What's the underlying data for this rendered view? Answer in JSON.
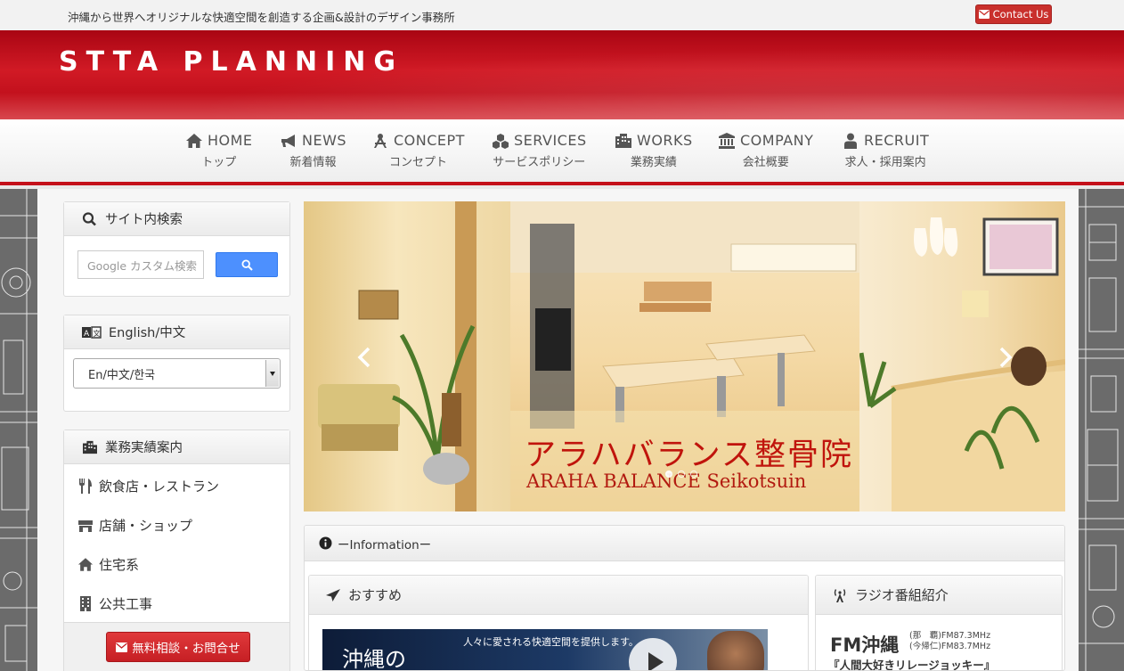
{
  "topbar": {
    "tagline": "沖縄から世界へオリジナルな快適空間を創造する企画&設計のデザイン事務所",
    "contact_label": "Contact Us"
  },
  "header": {
    "brand": "STTA PLANNING"
  },
  "colors": {
    "brand_red": "#c4101a",
    "search_blue": "#4d90fe",
    "button_red": "#c9302c"
  },
  "nav": [
    {
      "icon": "home-icon",
      "label": "HOME",
      "sub": "トップ"
    },
    {
      "icon": "bullhorn-icon",
      "label": "NEWS",
      "sub": "新着情報"
    },
    {
      "icon": "compass-icon",
      "label": "CONCEPT",
      "sub": "コンセプト"
    },
    {
      "icon": "cubes-icon",
      "label": "SERVICES",
      "sub": "サービスポリシー"
    },
    {
      "icon": "building-icon",
      "label": "WORKS",
      "sub": "業務実績"
    },
    {
      "icon": "bank-icon",
      "label": "COMPANY",
      "sub": "会社概要"
    },
    {
      "icon": "user-icon",
      "label": "RECRUIT",
      "sub": "求人・採用案内"
    }
  ],
  "sidebar": {
    "search": {
      "title": "サイト内検索",
      "placeholder": "Google カスタム検索"
    },
    "language": {
      "title": "English/中文",
      "selected": "En/中文/한국"
    },
    "works": {
      "title": "業務実績案内",
      "items": [
        {
          "icon": "cutlery-icon",
          "label": "飲食店・レストラン"
        },
        {
          "icon": "shop-icon",
          "label": "店舗・ショップ"
        },
        {
          "icon": "home-icon",
          "label": "住宅系"
        },
        {
          "icon": "office-building-icon",
          "label": "公共工事"
        }
      ],
      "consult_label": "無料相談・お問合せ"
    }
  },
  "slider": {
    "title": "アラハバランス整骨院",
    "subtitle": "ARAHA BALANCE Seikotsuin",
    "slide_count": 3,
    "active_index": 0
  },
  "info": {
    "title": "ーInformationー",
    "recommend": {
      "title": "おすすめ",
      "video_brand": "沖縄の",
      "video_caption": "人々に愛される快適空間を提供します。"
    },
    "radio": {
      "title": "ラジオ番組紹介",
      "station": "FM沖縄",
      "freq_line1": "(那　覇)FM87.3MHz",
      "freq_line2": "(今帰仁)FM83.7MHz",
      "show": "『人間大好きリレージョッキー』"
    }
  }
}
